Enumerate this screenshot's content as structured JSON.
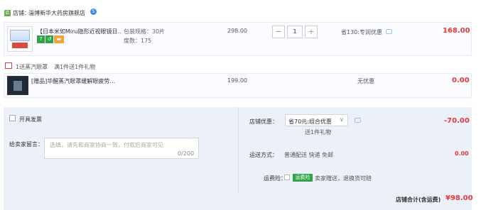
{
  "shop": {
    "label": "店铺：",
    "name": "淄博新华大药房旗舰店",
    "badge": "5"
  },
  "item": {
    "title": "【日本米如Miru隐形近视眼镜日…",
    "tags": [
      "7",
      "↺",
      "▬"
    ],
    "spec_line1": "包装规格：30片",
    "spec_line2": "度数：175",
    "price": "298.00",
    "quantity": "1",
    "minus": "−",
    "plus": "+",
    "saving": "省130:专润优惠",
    "total": "168.00"
  },
  "gift": {
    "promo_label": "1送蒸汽眼罩",
    "promo_rule": "满1件送1件礼物",
    "title": "[赠品]华醒蒸汽眼罩缓解眼疲劳…",
    "price": "199.00",
    "discount": "无优惠",
    "total": "0.00"
  },
  "summary": {
    "invoice_label": "开具发票",
    "message_label": "给卖家留言：",
    "message_placeholder": "选填，请先和商家协商一致，付款后商家可见",
    "message_count": "0/200",
    "discount_label": "店铺优惠：",
    "discount_value": "省70元:组合优惠",
    "discount_sub": "送1件礼物",
    "discount_amount": "-70.00",
    "shipping_label": "运送方式：",
    "shipping_value": "普通配送 快递 免邮",
    "shipping_amount": "0.00",
    "insurance_label": "运费险：",
    "insurance_badge": "运费险",
    "insurance_text": "卖家赠送，退换货可赔",
    "total_label": "店铺合计(含运费)",
    "total_amount": "¥98.00"
  },
  "colors": {
    "accent_red": "#e4393c",
    "summary_bg": "#ecf1f9",
    "tag_green": "#2fa34a"
  }
}
